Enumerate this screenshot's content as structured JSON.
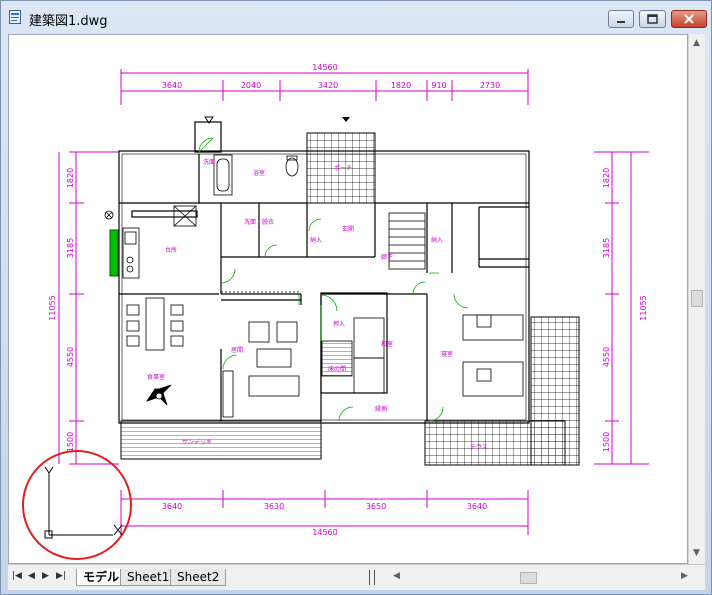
{
  "window": {
    "title": "建築図1.dwg"
  },
  "drawing": {
    "overall_width": "14560",
    "top_dims": [
      "3640",
      "2040",
      "3420",
      "1820",
      "910",
      "2730"
    ],
    "bottom_dims": [
      "3640",
      "3630",
      "3650",
      "3640"
    ],
    "overall_depth": "11055",
    "left_dims": [
      "1820",
      "3185",
      "4550",
      "1500"
    ],
    "right_dims": [
      "1820",
      "3185",
      "4550",
      "1500"
    ],
    "rooms": {
      "wash": "洗面",
      "bath": "浴室",
      "porch": "ポーチ",
      "washroom": "洗面・脱衣",
      "entrance": "玄関",
      "kitchen": "台所",
      "storage1": "納入",
      "storage2": "納入",
      "storage3": "納入",
      "living": "居間",
      "dining": "食事室",
      "japanese": "和室",
      "bedroom": "寝室",
      "engawa": "縁側",
      "closet": "押入",
      "tokonoma": "床の間",
      "deck": "サンデッキ",
      "terrace": "テラス",
      "hall": "廊下"
    }
  },
  "tabs": [
    "モデル",
    "Sheet1",
    "Sheet2"
  ],
  "colors": {
    "dimension": "#d000d0",
    "walls": "#000000",
    "doors": "#00b000",
    "ucs": "#e02020"
  }
}
